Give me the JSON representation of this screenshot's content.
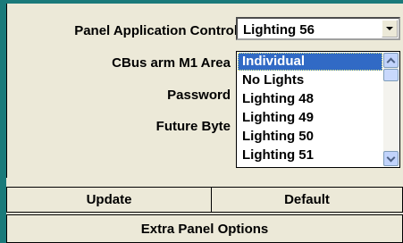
{
  "form": {
    "panel_application_control_label": "Panel Application Control",
    "cbus_arm_area_label": "CBus arm M1 Area",
    "password_label": "Password",
    "future_byte_label": "Future Byte"
  },
  "combo": {
    "selected_value": "Lighting 56",
    "button_icon": "triangle-down-icon"
  },
  "dropdown": {
    "items": [
      {
        "label": "Individual",
        "selected": true
      },
      {
        "label": "No Lights",
        "selected": false
      },
      {
        "label": "Lighting 48",
        "selected": false
      },
      {
        "label": "Lighting 49",
        "selected": false
      },
      {
        "label": "Lighting 50",
        "selected": false
      },
      {
        "label": "Lighting 51",
        "selected": false
      }
    ],
    "scroll_up_icon": "chevron-up-icon",
    "scroll_down_icon": "chevron-down-icon"
  },
  "buttons": {
    "update_label": "Update",
    "default_label": "Default",
    "extra_panel_options_label": "Extra Panel Options"
  },
  "colors": {
    "frame": "#1a7a7a",
    "selection": "#316ac5",
    "background": "#ece9d8"
  }
}
